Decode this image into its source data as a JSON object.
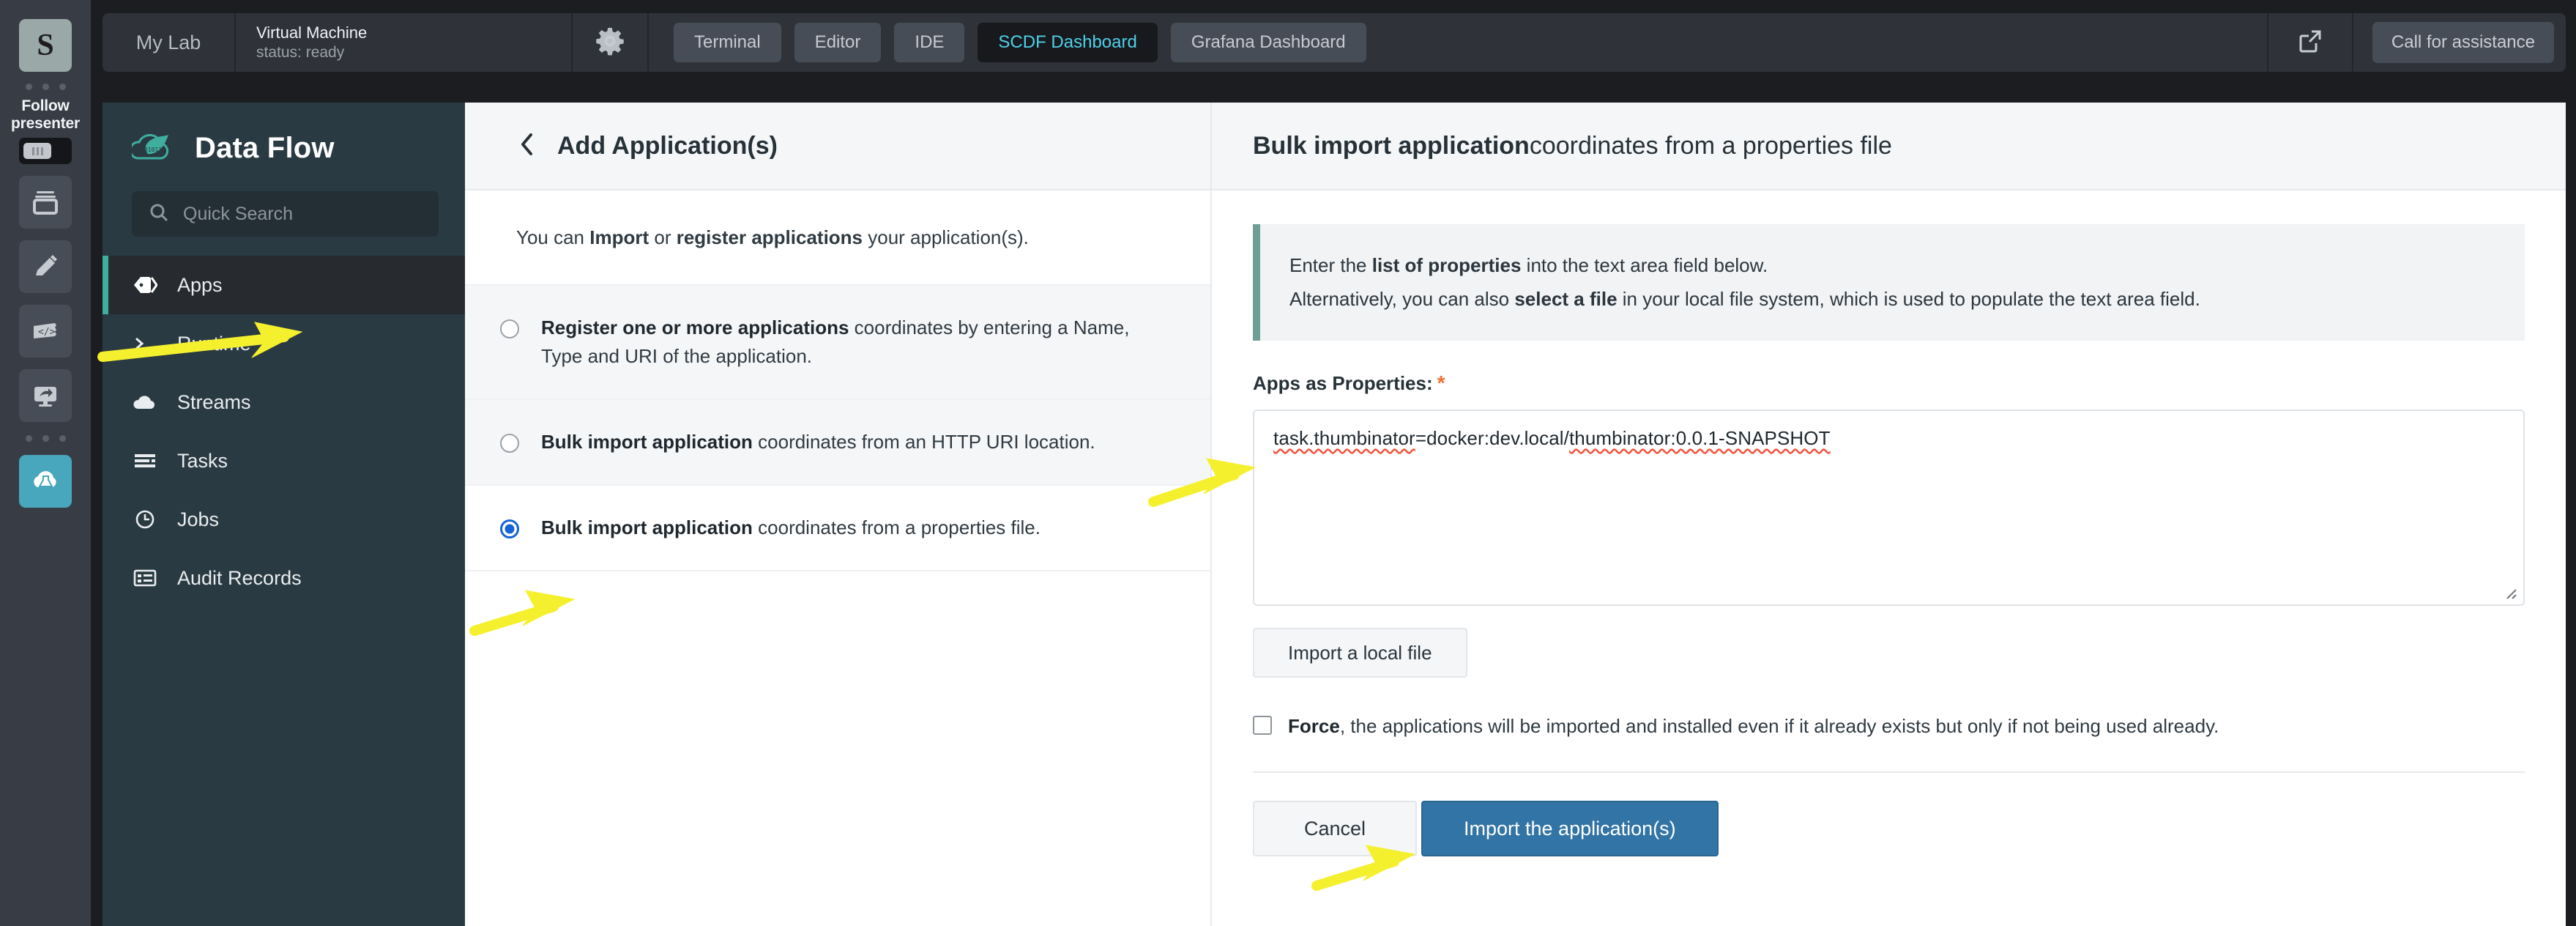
{
  "rail": {
    "avatar_letter": "S",
    "follow_label": "Follow\npresenter",
    "icons": [
      "layers-icon",
      "marker-pen-icon",
      "code-snippet-icon",
      "screen-share-icon",
      "cloud-flask-icon"
    ]
  },
  "topbar": {
    "mylab_label": "My Lab",
    "vm_title": "Virtual Machine",
    "vm_status": "status: ready",
    "gear_icon": "gear-icon",
    "external_link_icon": "external-link-icon",
    "assistance_label": "Call for assistance",
    "tabs": [
      {
        "label": "Terminal",
        "active": false
      },
      {
        "label": "Editor",
        "active": false
      },
      {
        "label": "IDE",
        "active": false
      },
      {
        "label": "SCDF Dashboard",
        "active": true
      },
      {
        "label": "Grafana Dashboard",
        "active": false
      }
    ],
    "active_tab_color": "#4fd0e8"
  },
  "dataflow_sidebar": {
    "brand": "Data Flow",
    "brand_icon": "spring-cloud-dataflow-logo",
    "search_placeholder": "Quick Search",
    "search_icon": "search-icon",
    "accent_color": "#3fae9f",
    "items": [
      {
        "label": "Apps",
        "icon": "tag-icon",
        "active": true
      },
      {
        "label": "Runtime",
        "icon": "terminal-prompt-icon",
        "active": false
      },
      {
        "label": "Streams",
        "icon": "cloud-icon",
        "active": false
      },
      {
        "label": "Tasks",
        "icon": "task-list-icon",
        "active": false
      },
      {
        "label": "Jobs",
        "icon": "clock-icon",
        "active": false
      },
      {
        "label": "Audit Records",
        "icon": "records-icon",
        "active": false
      }
    ]
  },
  "mid_panel": {
    "back_icon": "chevron-left-icon",
    "title": "Add Application(s)",
    "intro": {
      "p1": "You can ",
      "b1": "Import",
      "p2": " or ",
      "b2": "register applications",
      "p3": " your application(s)."
    },
    "options": [
      {
        "bold": "Register one or more applications",
        "rest": " coordinates by entering a Name, Type and URI of the application.",
        "selected": false,
        "shaded": true
      },
      {
        "bold": "Bulk import application",
        "rest": " coordinates from an HTTP URI location.",
        "selected": false,
        "shaded": true
      },
      {
        "bold": "Bulk import application",
        "rest": " coordinates from a properties file.",
        "selected": true,
        "shaded": false
      }
    ]
  },
  "right_panel": {
    "title_bold": "Bulk import application",
    "title_rest": " coordinates from a properties file",
    "callout_line1_a": "Enter the ",
    "callout_line1_b": "list of properties",
    "callout_line1_c": " into the text area field below.",
    "callout_line2_a": "Alternatively, you can also ",
    "callout_line2_b": "select a file",
    "callout_line2_c": " in your local file system, which is used to populate the text area field.",
    "callout_accent": "#6f9e97",
    "field_label": "Apps as Properties:",
    "field_required_marker": "*",
    "required_color": "#f07030",
    "textarea_value": "task.thumbinator=docker:dev.local/thumbinator:0.0.1-SNAPSHOT",
    "textarea_token_1": "task.thumbinator",
    "textarea_token_2": "=docker:dev.local/",
    "textarea_token_3": "thumbinator:0.0.1-SNAPSHOT",
    "import_local_label": "Import a local file",
    "force_bold": "Force",
    "force_rest": ", the applications will be imported and installed even if it already exists but only if not being used already.",
    "force_checked": false,
    "cancel_label": "Cancel",
    "import_label": "Import the application(s)",
    "import_button_color": "#3274a5"
  },
  "annotations": {
    "arrow_color": "#f5f02e",
    "arrows": [
      {
        "name": "arrow-to-apps-nav"
      },
      {
        "name": "arrow-to-properties-file-radio"
      },
      {
        "name": "arrow-to-properties-textarea"
      },
      {
        "name": "arrow-to-import-button"
      }
    ]
  }
}
